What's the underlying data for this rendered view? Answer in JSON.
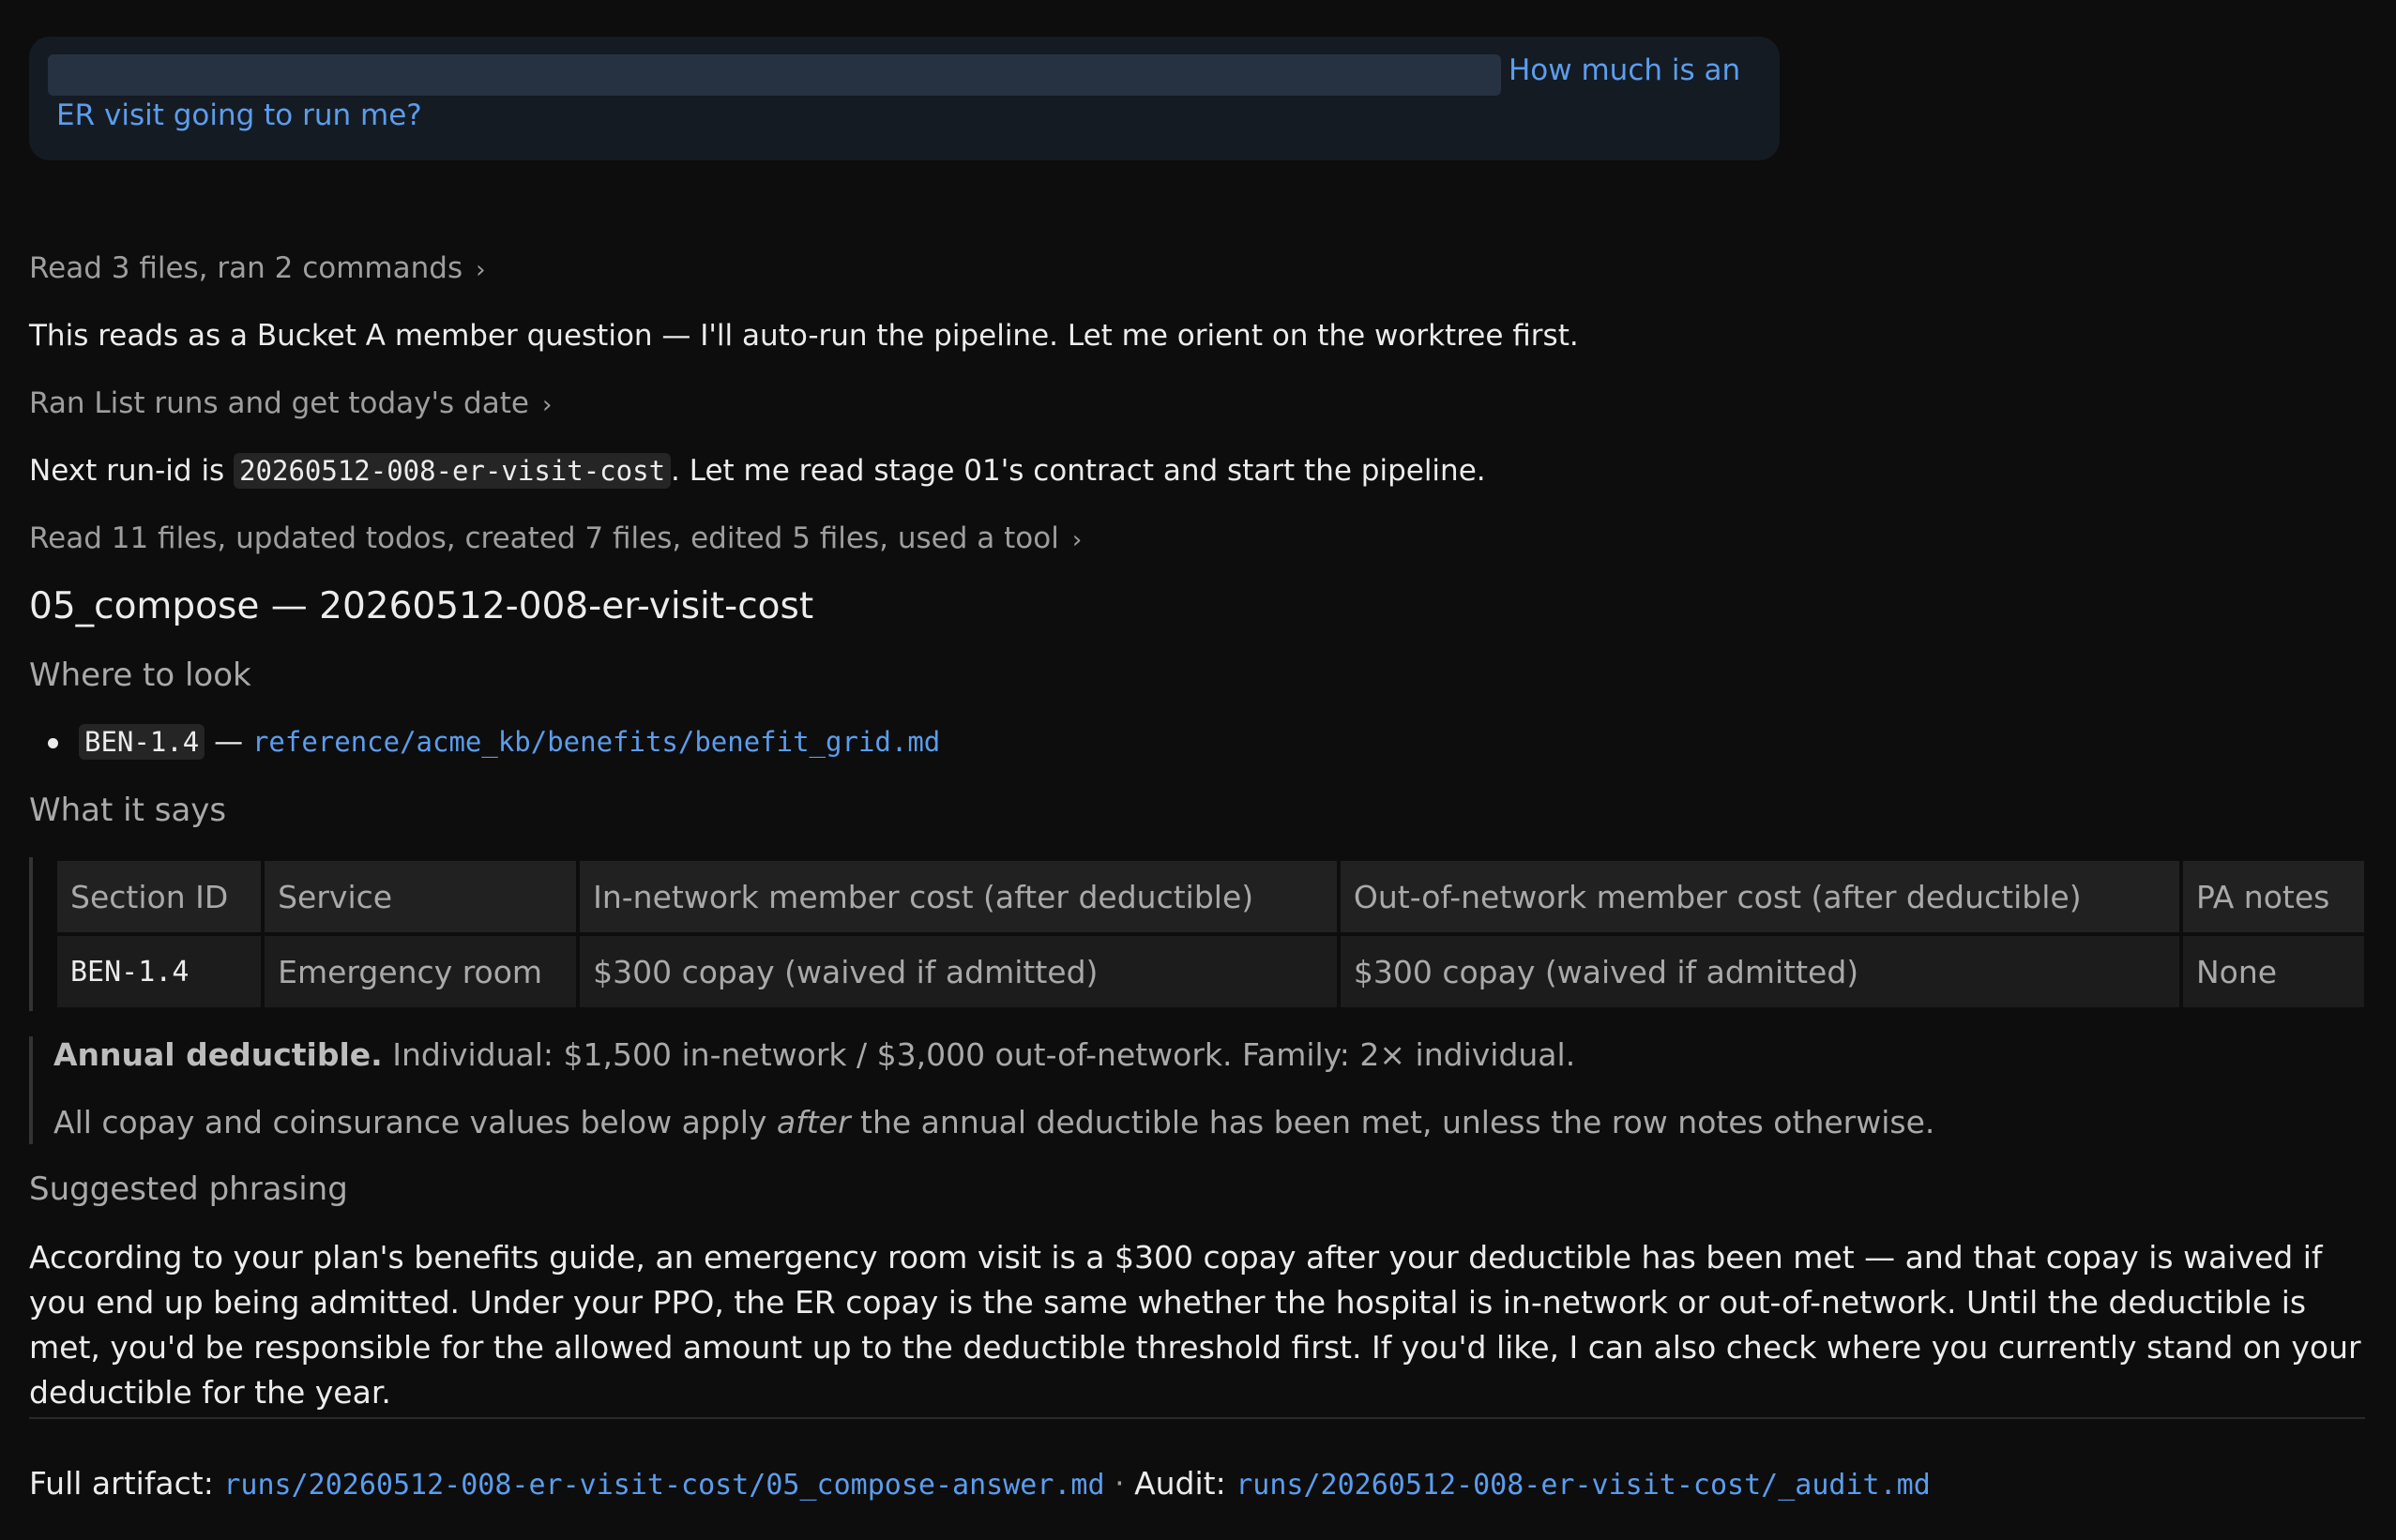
{
  "user_message": {
    "line1": "How much is an",
    "line2": "ER visit going to run me?"
  },
  "activity": {
    "step1": "Read 3 files, ran 2 commands",
    "text1": "This reads as a Bucket A member question — I'll auto-run the pipeline. Let me orient on the worktree first.",
    "step2": "Ran List runs and get today's date",
    "text2_prefix": "Next run-id is",
    "text2_code": "20260512-008-er-visit-cost",
    "text2_suffix": ". Let me read stage 01's contract and start the pipeline.",
    "step3": "Read 11 files, updated todos, created 7 files, edited 5 files, used a tool",
    "chevron": "›"
  },
  "answer": {
    "title": "05_compose — 20260512-008-er-visit-cost",
    "where_heading": "Where to look",
    "where_items": [
      {
        "code": "BEN-1.4",
        "sep": "—",
        "path": "reference/acme_kb/benefits/benefit_grid.md"
      }
    ],
    "what_heading": "What it says",
    "table": {
      "headers": [
        "Section ID",
        "Service",
        "In-network member cost (after deductible)",
        "Out-of-network member cost (after deductible)",
        "PA notes"
      ],
      "rows": [
        [
          "BEN-1.4",
          "Emergency room",
          "$300 copay (waived if admitted)",
          "$300 copay (waived if admitted)",
          "None"
        ]
      ]
    },
    "quote": {
      "bold": "Annual deductible.",
      "line1_rest": " Individual: $1,500 in-network / $3,000 out-of-network. Family: 2× individual.",
      "line2_pre": "All copay and coinsurance values below apply ",
      "line2_em": "after",
      "line2_post": " the annual deductible has been met, unless the row notes otherwise."
    },
    "suggested_heading": "Suggested phrasing",
    "suggested_text": "According to your plan's benefits guide, an emergency room visit is a $300 copay after your deductible has been met — and that copay is waived if you end up being admitted. Under your PPO, the ER copay is the same whether the hospital is in-network or out-of-network. Until the deductible is met, you'd be responsible for the allowed amount up to the deductible threshold first. If you'd like, I can also check where you currently stand on your deductible for the year."
  },
  "footer": {
    "artifact_label": "Full artifact:",
    "artifact_path": "runs/20260512-008-er-visit-cost/05_compose-answer.md",
    "sep": "·",
    "audit_label": "Audit:",
    "audit_path": "runs/20260512-008-er-visit-cost/_audit.md"
  }
}
